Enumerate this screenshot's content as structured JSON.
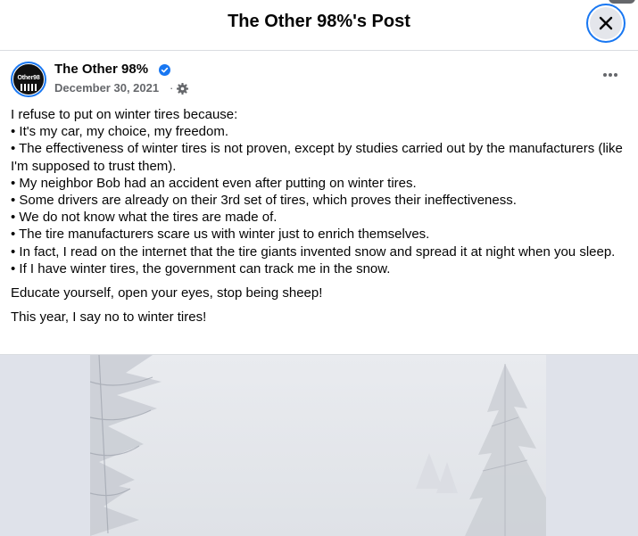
{
  "dialog": {
    "title": "The Other 98%'s Post",
    "close_icon": "close-icon"
  },
  "post": {
    "author": "The Other 98%",
    "avatar_text": "Other98",
    "verified_icon": "verified-badge-icon",
    "date": "December 30, 2021",
    "separator": "·",
    "audience_icon": "gear-icon",
    "more_icon": "more-options-icon",
    "lines": [
      "I refuse to put on winter tires because:",
      "• It's my car, my choice, my freedom.",
      "• The effectiveness of winter tires is not proven, except by studies carried out by the manufacturers (like I'm supposed to trust them).",
      "• My neighbor Bob had an accident even after putting on winter tires.",
      "• Some drivers are already on their 3rd set of tires, which proves their ineffectiveness.",
      "• We do not know what the tires are made of.",
      "• The tire manufacturers scare us with winter just to enrich themselves.",
      "• In fact, I read on the internet that the tire giants invented snow and spread it at night when you sleep.",
      "• If I have winter tires, the government can track me in the snow."
    ],
    "paragraph_2": "Educate yourself, open your eyes, stop being sheep!",
    "paragraph_3": "This year, I say no to winter tires!"
  },
  "colors": {
    "accent": "#1877f2",
    "secondary_text": "#65676b",
    "divider": "#dadde1"
  }
}
